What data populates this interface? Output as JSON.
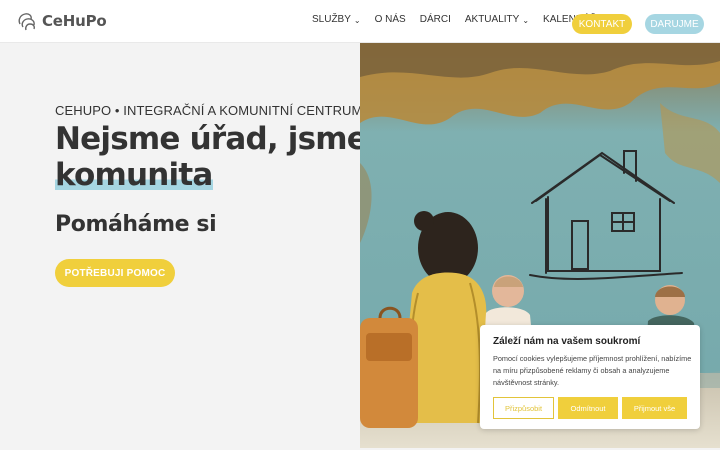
{
  "header": {
    "logo_text": "CeHuPo",
    "nav": [
      {
        "label": "SLUŽBY",
        "has_dropdown": true
      },
      {
        "label": "O NÁS",
        "has_dropdown": false
      },
      {
        "label": "DÁRCI",
        "has_dropdown": false
      },
      {
        "label": "AKTUALITY",
        "has_dropdown": true
      },
      {
        "label": "KALENDÁŘ",
        "has_dropdown": false
      }
    ],
    "contact_label": "KONTAKT",
    "donate_label": "DARUJME",
    "chevron": "⌄"
  },
  "hero": {
    "subtitle": "CEHUPO • INTEGRAČNÍ A KOMUNITNÍ CENTRUM",
    "headline_line1": "Nejsme úřad, jsme",
    "headline_highlight": "komunita",
    "tagline": "Pomáháme si",
    "cta_label": "POTŘEBUJI POMOC"
  },
  "cookie_banner": {
    "title": "Záleží nám na vašem soukromí",
    "text": "Pomocí cookies vylepšujeme příjemnost prohlížení, nabízíme na míru přizpůsobené reklamy či obsah a analyzujeme návštěvnost stránky.",
    "customize_label": "Přizpůsobit",
    "deny_label": "Odmítnout",
    "accept_label": "Přijmout vše"
  },
  "colors": {
    "accent_yellow": "#f0cf3c",
    "accent_blue": "#a6d6e2",
    "text_dark": "#333333",
    "hero_bg": "#f3f3f3",
    "illustration_teal": "#7fb3b5"
  }
}
